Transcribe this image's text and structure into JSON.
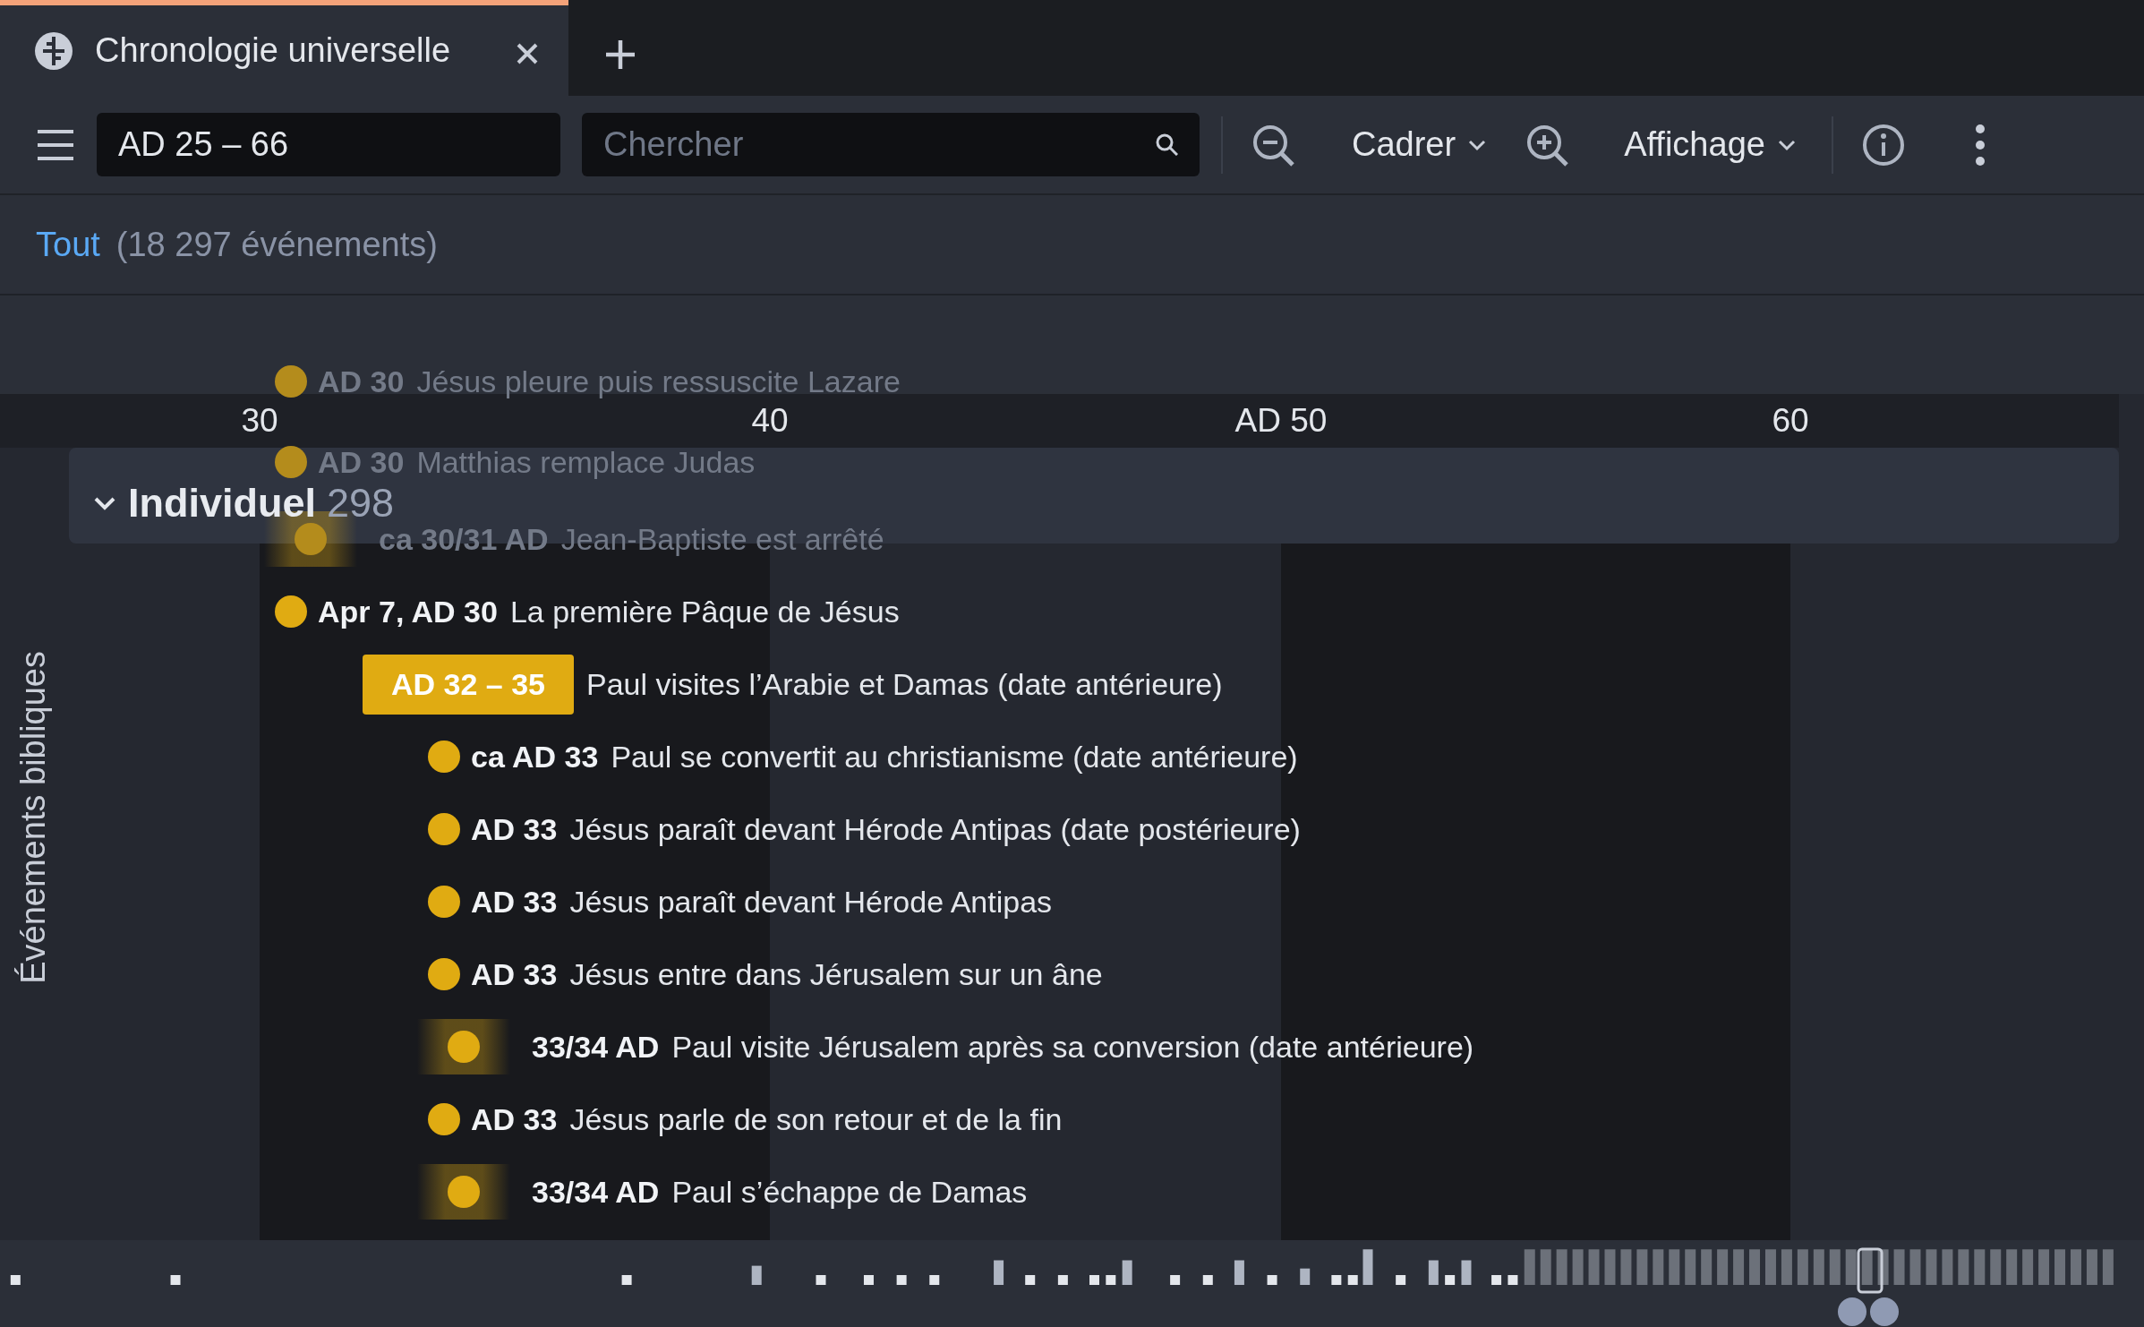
{
  "tab": {
    "title": "Chronologie universelle",
    "selected": true
  },
  "toolbar": {
    "range": "AD 25 – 66",
    "search": {
      "placeholder": "Chercher"
    },
    "menus": [
      "Cadrer",
      "Affichage"
    ]
  },
  "filter": {
    "link": "Tout",
    "count": "(18 297 événements)"
  },
  "timeline": {
    "lane": "Événements bibliques",
    "axis": [
      "30",
      "40",
      "AD 50",
      "60"
    ],
    "group": {
      "name": "Individuel",
      "count": "298",
      "expanded": true
    },
    "events": [
      {
        "kind": "point",
        "date": "AD 30",
        "title": "Jésus pleure puis ressuscite Lazare",
        "dimmed": true
      },
      {
        "kind": "point",
        "date": "AD 30",
        "title": "Matthias remplace Judas",
        "dimmed": true
      },
      {
        "kind": "fuzzy",
        "date": "ca 30/31 AD",
        "title": "Jean-Baptiste est arrêté",
        "dimmed": true
      },
      {
        "kind": "point",
        "date": "Apr 7, AD 30",
        "title": "La première Pâque de Jésus"
      },
      {
        "kind": "range",
        "date": "AD 32 – 35",
        "title": "Paul visites l’Arabie et Damas (date antérieure)"
      },
      {
        "kind": "point",
        "date": "ca AD 33",
        "title": "Paul se convertit au christianisme (date antérieure)"
      },
      {
        "kind": "point",
        "date": "AD 33",
        "title": "Jésus paraît devant Hérode Antipas (date postérieure)"
      },
      {
        "kind": "point",
        "date": "AD 33",
        "title": "Jésus paraît devant Hérode Antipas"
      },
      {
        "kind": "point",
        "date": "AD 33",
        "title": "Jésus entre dans Jérusalem sur un âne"
      },
      {
        "kind": "fuzzy",
        "date": "33/34 AD",
        "title": "Paul visite Jérusalem après sa conversion (date antérieure)"
      },
      {
        "kind": "point",
        "date": "AD 33",
        "title": "Jésus parle de son retour et de la fin"
      },
      {
        "kind": "fuzzy",
        "date": "33/34 AD",
        "title": "Paul s’échappe de Damas"
      }
    ]
  }
}
